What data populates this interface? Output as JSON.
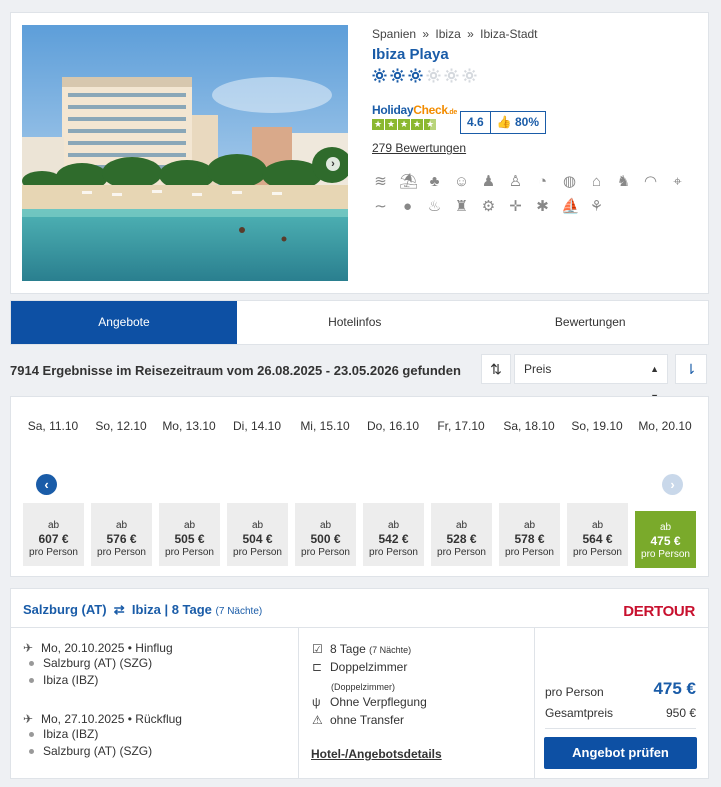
{
  "hotel": {
    "breadcrumb": [
      "Spanien",
      "Ibiza",
      "Ibiza-Stadt"
    ],
    "breadcrumb_sep": "»",
    "name": "Ibiza Playa",
    "sun_rating": 3,
    "sun_max": 6,
    "holidaycheck": {
      "logo_part1": "Holiday",
      "logo_part2": "Check",
      "logo_suffix": ".de",
      "score": "4.6",
      "recommend": "80%",
      "stars": 4.5
    },
    "reviews_link": "279 Bewertungen",
    "amenities": [
      "water-aerobics-icon",
      "beach-umbrella-icon",
      "palm-beach-icon",
      "animation-icon",
      "kids-club-icon",
      "family-icon",
      "snorkel-icon",
      "globe-icon",
      "shop-icon",
      "playground-icon",
      "wifi-icon",
      "location-icon",
      "swimming-icon",
      "ball-icon",
      "massage-icon",
      "fitness-icon",
      "bicycle-icon",
      "dart-icon",
      "gymnastics-icon",
      "jetski-icon",
      "sauna-icon"
    ]
  },
  "tabs": [
    {
      "label": "Angebote",
      "active": true
    },
    {
      "label": "Hotelinfos",
      "active": false
    },
    {
      "label": "Bewertungen",
      "active": false
    }
  ],
  "results": {
    "text": "7914 Ergebnisse im Reisezeitraum vom 26.08.2025 - 23.05.2026 gefunden",
    "sort_label": "Preis"
  },
  "calendar": {
    "prefix": "ab",
    "suffix": "pro Person",
    "days": [
      {
        "label": "Sa, 11.10",
        "price": "607 €"
      },
      {
        "label": "So, 12.10",
        "price": "576 €"
      },
      {
        "label": "Mo, 13.10",
        "price": "505 €"
      },
      {
        "label": "Di, 14.10",
        "price": "504 €"
      },
      {
        "label": "Mi, 15.10",
        "price": "500 €"
      },
      {
        "label": "Do, 16.10",
        "price": "542 €"
      },
      {
        "label": "Fr, 17.10",
        "price": "528 €"
      },
      {
        "label": "Sa, 18.10",
        "price": "578 €"
      },
      {
        "label": "So, 19.10",
        "price": "564 €"
      },
      {
        "label": "Mo, 20.10",
        "price": "475 €"
      }
    ],
    "selected_index": 9
  },
  "offer": {
    "origin": "Salzburg (AT)",
    "destination": "Ibiza",
    "sep": "|",
    "duration": "8 Tage",
    "nights": "(7 Nächte)",
    "operator": "DERTOUR",
    "outbound": {
      "date": "Mo, 20.10.2025",
      "type": "• Hinflug",
      "from": "Salzburg (AT) (SZG)",
      "to": "Ibiza (IBZ)"
    },
    "return": {
      "date": "Mo, 27.10.2025",
      "type": "• Rückflug",
      "from": "Ibiza (IBZ)",
      "to": "Salzburg (AT) (SZG)"
    },
    "stay_duration": "8 Tage",
    "stay_nights": "(7 Nächte)",
    "room": "Doppelzimmer",
    "room_sub": "(Doppelzimmer)",
    "board": "Ohne Verpflegung",
    "transfer": "ohne Transfer",
    "details_link": "Hotel-/Angebotsdetails",
    "per_person_label": "pro Person",
    "per_person_value": "475 €",
    "total_label": "Gesamtpreis",
    "total_value": "950 €",
    "cta": "Angebot prüfen"
  }
}
